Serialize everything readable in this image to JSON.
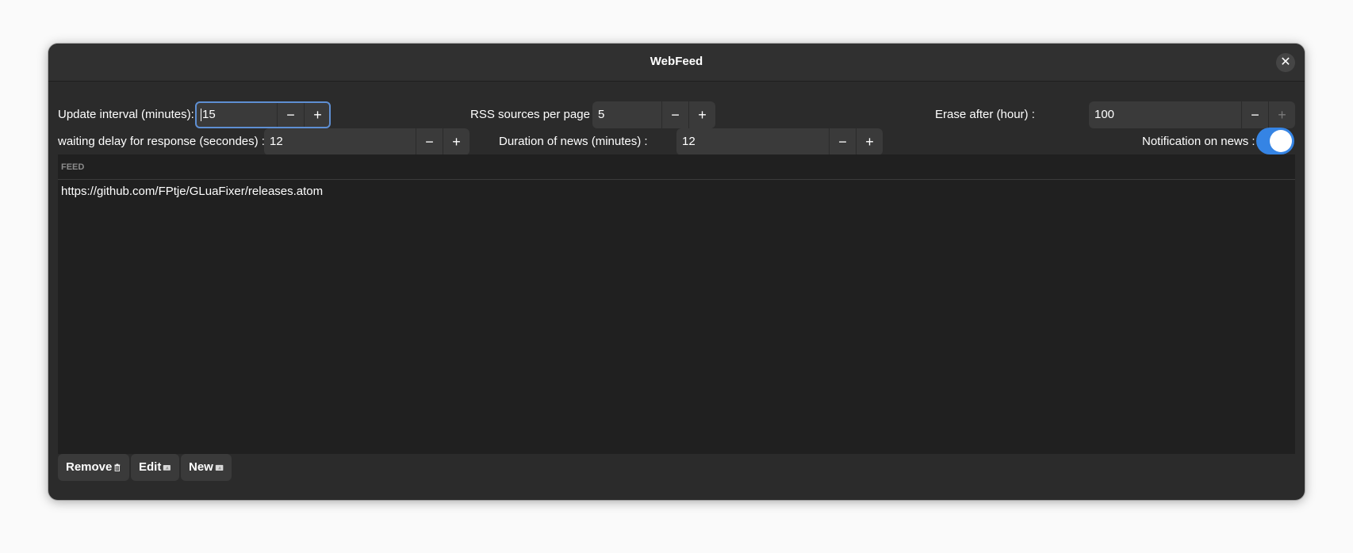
{
  "window": {
    "title": "WebFeed",
    "close_label": "✕"
  },
  "settings": {
    "update_interval": {
      "label": "Update interval (minutes):",
      "value": "15",
      "minus": "−",
      "plus": "+"
    },
    "rss_per_page": {
      "label": "RSS sources per page :",
      "value": "5",
      "minus": "−",
      "plus": "+"
    },
    "erase_after": {
      "label": "Erase after (hour) :",
      "value": "100",
      "minus": "−",
      "plus": "+"
    },
    "response_delay": {
      "label": "waiting delay for response (secondes) :",
      "value": "12",
      "minus": "−",
      "plus": "+"
    },
    "news_duration": {
      "label": "Duration of news (minutes) :",
      "value": "12",
      "minus": "−",
      "plus": "+"
    },
    "notification": {
      "label": "Notification on news :",
      "enabled": true
    }
  },
  "feed_list": {
    "header": "FEED",
    "rows": [
      "https://github.com/FPtje/GLuaFixer/releases.atom"
    ]
  },
  "actions": {
    "remove_label": "Remove",
    "edit_label": "Edit",
    "new_label": "New"
  },
  "colors": {
    "accent": "#3584e4",
    "window_bg": "#2b2b2b",
    "list_bg": "#202020"
  },
  "icons": {
    "close": "close-icon",
    "remove": "trash-icon",
    "edit": "document-edit-icon",
    "new": "document-new-icon"
  }
}
